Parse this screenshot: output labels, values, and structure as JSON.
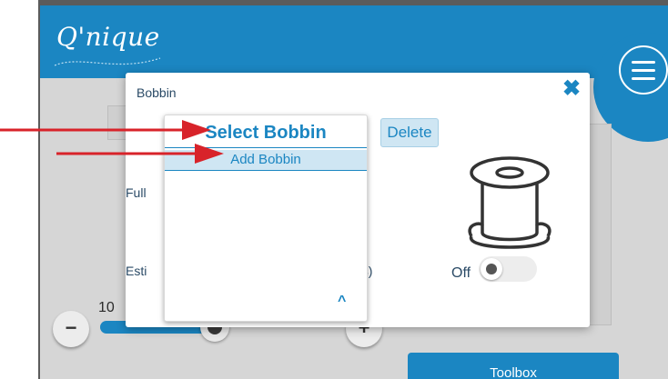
{
  "app": {
    "logo_text": "Q'nique"
  },
  "background": {
    "slider_value": "10",
    "minus_label": "−",
    "plus_label": "+",
    "toolbox_label": "Toolbox",
    "slider_level_fraction": 0.85
  },
  "dialog": {
    "title": "Bobbin",
    "close_icon": "close-x-icon",
    "delete_label": "Delete",
    "full_label_partial": "Full",
    "estimate_label_partial": "Esti",
    "estimate_suffix_partial": "ds)",
    "toggle_label": "Off",
    "toggle_on": false,
    "spool_icon": "bobbin-spool-icon"
  },
  "dropdown": {
    "header": "Select Bobbin",
    "items": [
      {
        "label": "Add Bobbin"
      }
    ],
    "chevron_icon": "chevron-up-icon"
  },
  "colors": {
    "brand_blue": "#1b86c2",
    "arrow_red": "#d8232a"
  }
}
